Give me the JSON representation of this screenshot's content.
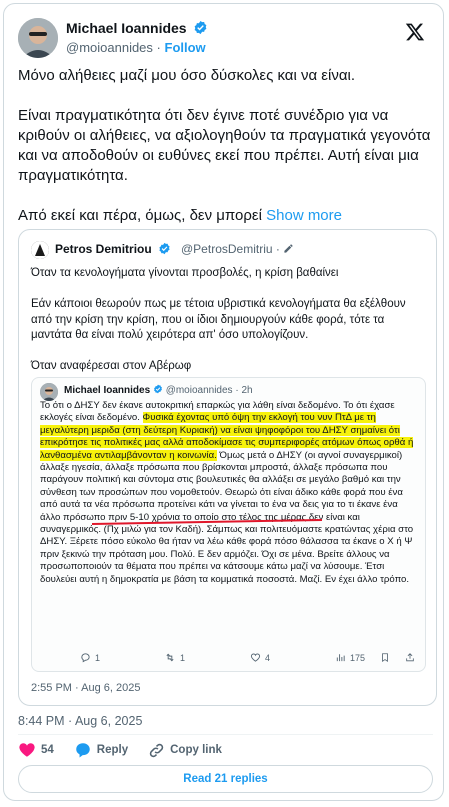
{
  "tweet": {
    "author_name": "Michael Ioannides",
    "author_handle": "@moioannides",
    "separator": "·",
    "follow_label": "Follow",
    "paragraphs": [
      "Μόνο αλήθειες μαζί μου όσο δύσκολες και να είναι.",
      "Είναι πραγματικότητα ότι δεν έγινε ποτέ συνέδριο για να κριθούν οι αλήθειες, να αξιολογηθούν τα πραγματικά γεγονότα και να αποδοθούν οι ευθύνες εκεί που πρέπει. Αυτή είναι μια πραγματικότητα."
    ],
    "truncated_text": "Από εκεί και πέρα, όμως, δεν μπορεί",
    "show_more_label": "Show more",
    "timestamp": "8:44 PM · Aug 6, 2025",
    "likes": "54",
    "reply_label": "Reply",
    "copy_link_label": "Copy link",
    "read_replies_label": "Read 21 replies",
    "brand_color": "#1d9bf0",
    "like_color": "#f91880"
  },
  "quote": {
    "author_name": "Petros Demitriou",
    "author_handle": "@PetrosDemitriu",
    "separator": "·",
    "paragraphs": [
      "Όταν τα κενολογήματα γίνονται προσβολές, η κρίση βαθαίνει",
      "Εάν κάποιοι θεωρούν πως με τέτοια υβριστικά κενολογήματα θα εξέλθουν από την κρίση την κρίση, που οι ίδιοι δημιουργούν κάθε φορά, τότε τα μαντάτα θα είναι πολύ χειρότερα απ' όσο υπολογίζουν.",
      "Όταν αναφέρεσαι στον Αβέρωφ"
    ],
    "timestamp": "2:55 PM · Aug 6, 2025"
  },
  "inner": {
    "author_name": "Michael Ioannides",
    "author_handle": "@moioannides",
    "age": "· 2h",
    "text_a": "Το ότι ο ΔΗΣΥ δεν έκανε αυτοκριτική επαρκώς για λάθη είναι δεδομένο. Το ότι έχασε εκλογές είναι δεδομένο. ",
    "text_hl1": "Φυσικά έχοντας υπό όψη την εκλογή του νυν ΠτΔ με τη μεγαλύτερη μεριδα (στη δεύτερη Κυριακή) να είναι ψηφοφόροι του ΔΗΣΥ σημαίνει ότι επικρότησε τις πολιτικές μας αλλά ",
    "text_hl2": "αποδοκίμασε τις συμπεριφορές ατόμων",
    "text_hl3": " όπως ορθά ή λανθασμένα αντιλαμβάνονταν η κοινωνία.",
    "text_b": " Όμως μετά ο ΔΗΣΥ (οι αγνοί συναγερμικοί) άλλαξε ηγεσία, άλλαξε πρόσωπα που βρίσκονται μπροστά, άλλαξε πρόσωπα που παράγουν πολιτική και σύντομα στις βουλευτικές θα αλλάξει σε μεγάλο βαθμό και την σύνθεση των προσώπων που νομοθετούν. Θεωρώ ότι είναι άδικο κάθε φορά που ένα από αυτά τα νέα πρόσωπα προτείνει κάτι να γίνεται το ένα να δεις για το τι έκανε ένα άλλο πρόσωπο πριν 5-10 χρόνια το οποίο στο τέλος της μέρας δεν είναι και συναγερμικός. (Πχ μιλώ για τον Καδή). Σάμπως και πολιτευόμαστε κρατώντας χέρια στο ΔΗΣΥ. Ξέρετε πόσο εύκολο θα ήταν να λέω κάθε φορά πόσο θάλασσα τα έκανε ο Χ ή Ψ πριν ξεκινώ την πρόταση μου. Πολύ. Ε δεν αρμόζει. Όχι σε μένα. Βρείτε άλλους να προσωποποιούν τα θέματα που πρέπει να κάτσουμε κάτω μαζί να λύσουμε. Έτσι δουλεύει αυτή η δημοκρατία με βάση τα κομματικά ποσοστά. Μαζί. Εν έχει άλλο τρόπο.",
    "actions": {
      "replies": "1",
      "reposts": "1",
      "likes": "4",
      "views": "175"
    },
    "highlight_color": "#f7f20c"
  }
}
